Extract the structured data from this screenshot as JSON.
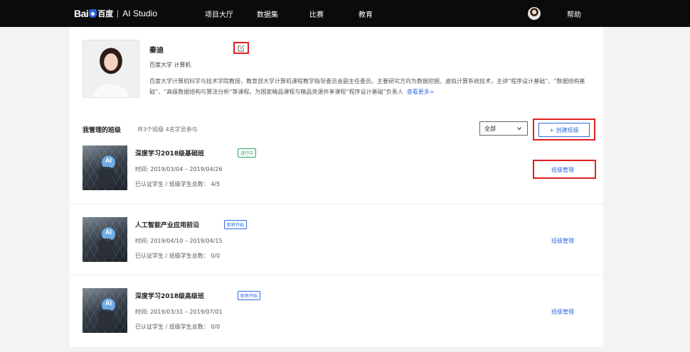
{
  "header": {
    "logo_bai": "Bai",
    "logo_du": "百度",
    "logo_studio": "AI Studio",
    "nav": [
      "项目大厅",
      "数据集",
      "比赛",
      "教育"
    ],
    "help": "帮助"
  },
  "profile": {
    "name": "秦迪",
    "school": "百度大学  计算机",
    "bio": "百度大学计算机科学与技术学院教授，教育部大学计算机课程教学指导委员会副主任委员。主要研究方向为数据挖掘、虚拟计算系统技术，主讲“程序设计基础”、“数据结构基础”、“高级数据结构与算法分析”等课程。为国家精品课程与精品资源共享课程“程序设计基础”负责人",
    "see_more": "查看更多>"
  },
  "classes_section": {
    "title": "我管理的班级",
    "summary": "共3个班级  4名学员参与",
    "filter_value": "全部",
    "create_label": "+ 创建班级",
    "thumb_label": "AI",
    "items": [
      {
        "title": "深度学习2018级基础班",
        "status": "进行中",
        "status_color": "#2aa860",
        "time": "时间:  2019/03/04 – 2019/04/26",
        "count": "已认证学生 / 班级学生总数：  4/5",
        "manage": "班级管理"
      },
      {
        "title": "人工智能产业应用前沿",
        "status": "即将开始",
        "status_color": "#2d6be4",
        "time": "时间:  2019/04/10 – 2019/04/15",
        "count": "已认证学生 / 班级学生总数：  0/0",
        "manage": "班级管理"
      },
      {
        "title": "深度学习2018级高级班",
        "status": "即将开始",
        "status_color": "#2d6be4",
        "time": "时间:  2019/03/31 – 2019/07/01",
        "count": "已认证学生 / 班级学生总数：  0/0",
        "manage": "班级管理"
      }
    ]
  }
}
